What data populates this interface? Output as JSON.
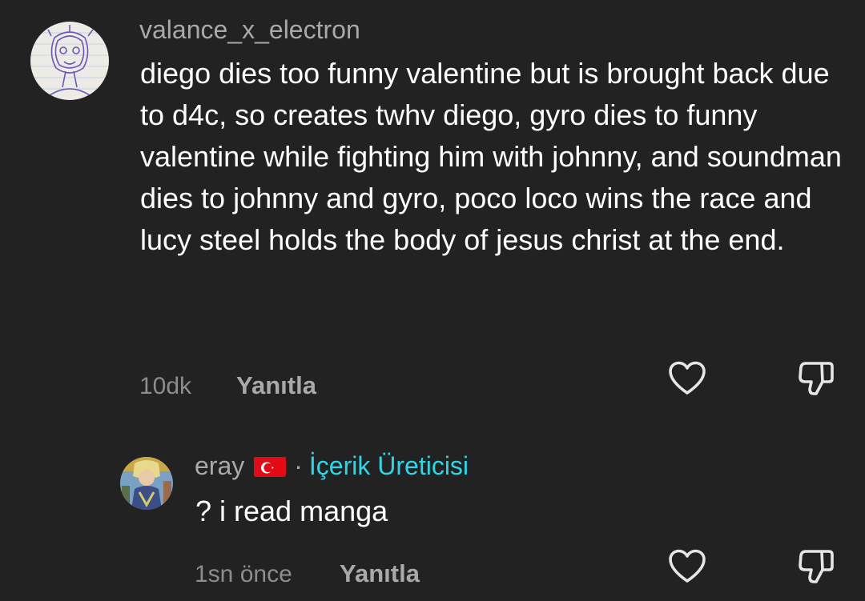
{
  "comments": [
    {
      "username": "valance_x_electron",
      "text": "diego dies too funny valentine but is brought back due to d4c, so creates twhv diego, gyro dies to funny valentine while fighting him with johnny, and soundman dies to johnny and gyro, poco loco wins the race and lucy steel holds the body of jesus christ at the end.",
      "time": "10dk",
      "reply_label": "Yanıtla",
      "icons": {
        "like": "heart-icon",
        "dislike": "thumbs-down-icon"
      }
    }
  ],
  "replies": [
    {
      "username": "eray",
      "flag": "turkey-flag-icon",
      "separator": "·",
      "creator_label": "İçerik Üreticisi",
      "text": "? i read manga",
      "time": "1sn önce",
      "reply_label": "Yanıtla",
      "icons": {
        "like": "heart-icon",
        "dislike": "thumbs-down-icon"
      }
    }
  ],
  "colors": {
    "background": "#222222",
    "username": "#a9a9a9",
    "body_text": "#ffffff",
    "meta": "#8d8d8d",
    "creator_badge": "#2fd6e6",
    "flag_red": "#e30a17"
  }
}
